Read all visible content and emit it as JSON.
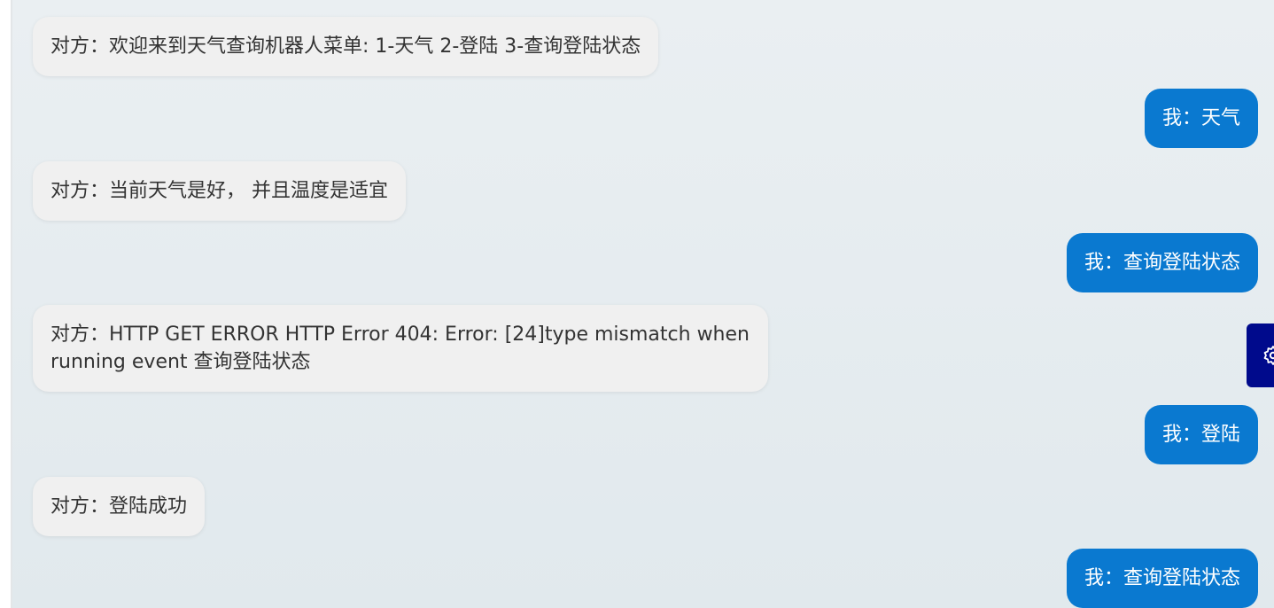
{
  "messages": [
    {
      "sender": "them",
      "text": "对方：欢迎来到天气查询机器人菜单: 1-天气 2-登陆 3-查询登陆状态"
    },
    {
      "sender": "me",
      "text": "我：天气"
    },
    {
      "sender": "them",
      "text": "对方：当前天气是好， 并且温度是适宜"
    },
    {
      "sender": "me",
      "text": "我：查询登陆状态"
    },
    {
      "sender": "them",
      "text": "对方：HTTP GET ERROR HTTP Error 404: Error: [24]type mismatch when running event 查询登陆状态"
    },
    {
      "sender": "me",
      "text": "我：登陆"
    },
    {
      "sender": "them",
      "text": "对方：登陆成功"
    },
    {
      "sender": "me",
      "text": "我：查询登陆状态"
    }
  ],
  "side_tab": {
    "icon": "settings-icon"
  },
  "colors": {
    "incoming_bubble": "#f0f0f0",
    "outgoing_bubble": "#0a79d0",
    "side_tab": "#000a8c",
    "background": "#e6edf0"
  }
}
